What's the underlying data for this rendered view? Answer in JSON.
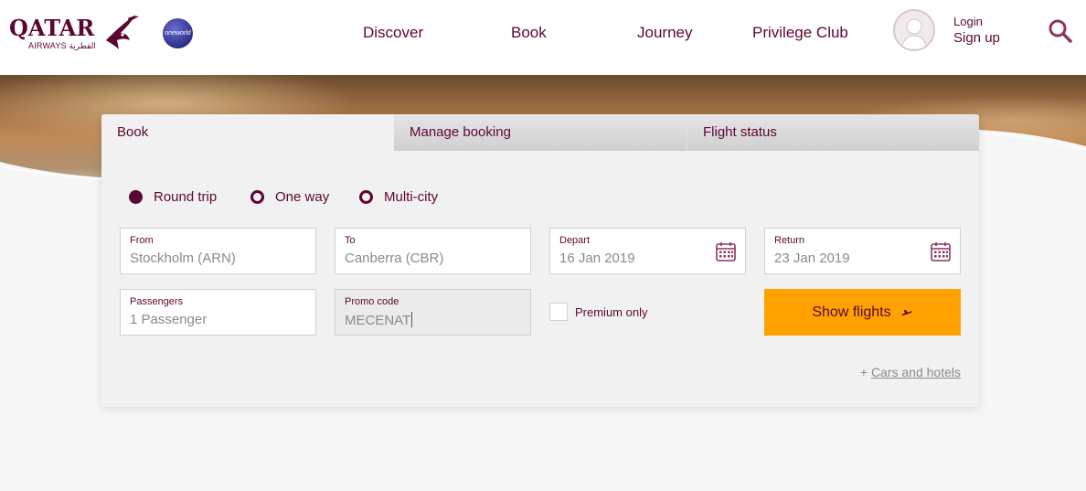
{
  "header": {
    "logo_text": "QATAR",
    "logo_sub": "AIRWAYS القطرية",
    "partner_badge": "oneworld",
    "nav": [
      "Discover",
      "Book",
      "Journey",
      "Privilege Club"
    ],
    "login": "Login",
    "signup": "Sign up",
    "icons": {
      "search": "search-icon",
      "avatar": "user-avatar-icon"
    }
  },
  "booking": {
    "tabs": [
      "Book",
      "Manage booking",
      "Flight status"
    ],
    "active_tab": "Book",
    "trip_types": [
      {
        "label": "Round trip",
        "selected": true
      },
      {
        "label": "One way",
        "selected": false
      },
      {
        "label": "Multi-city",
        "selected": false
      }
    ],
    "from": {
      "label": "From",
      "value": "Stockholm (ARN)"
    },
    "to": {
      "label": "To",
      "value": "Canberra (CBR)"
    },
    "depart": {
      "label": "Depart",
      "value": "16 Jan 2019"
    },
    "return": {
      "label": "Return",
      "value": "23 Jan 2019"
    },
    "passengers": {
      "label": "Passengers",
      "value": "1 Passenger"
    },
    "promo": {
      "label": "Promo code",
      "value": "MECENAT"
    },
    "premium_only": {
      "label": "Premium only",
      "checked": false
    },
    "show_flights": "Show flights",
    "cars_hotels_prefix": "+",
    "cars_hotels": "Cars and hotels"
  },
  "colors": {
    "brand": "#5c0632",
    "accent": "#ffa200",
    "panel_bg": "#f1f1f1"
  }
}
